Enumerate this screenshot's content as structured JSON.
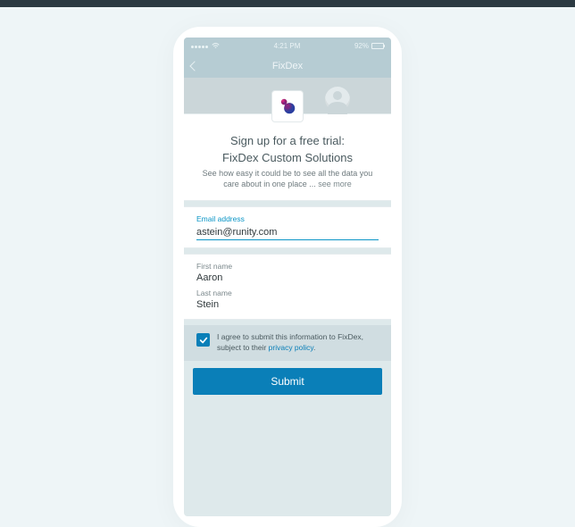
{
  "status_bar": {
    "time": "4:21 PM",
    "battery_pct": "92%"
  },
  "nav": {
    "title": "FixDex"
  },
  "header": {
    "title": "Sign up for a free trial:",
    "subtitle": "FixDex Custom Solutions",
    "description": "See how easy it could be to see all the data you care about in one place ... ",
    "see_more": "see more"
  },
  "form": {
    "email": {
      "label": "Email address",
      "value": "astein@runity.com"
    },
    "first_name": {
      "label": "First name",
      "value": "Aaron"
    },
    "last_name": {
      "label": "Last name",
      "value": "Stein"
    }
  },
  "consent": {
    "checked": true,
    "text_prefix": "I agree to submit this information to FixDex, subject to their ",
    "policy_link": "privacy policy",
    "text_suffix": "."
  },
  "submit_label": "Submit",
  "icons": {
    "back": "chevron-left",
    "app": "fixdex-logo",
    "check": "checkmark"
  },
  "colors": {
    "accent": "#0a7fb8",
    "input_focus": "#0a95c6"
  }
}
